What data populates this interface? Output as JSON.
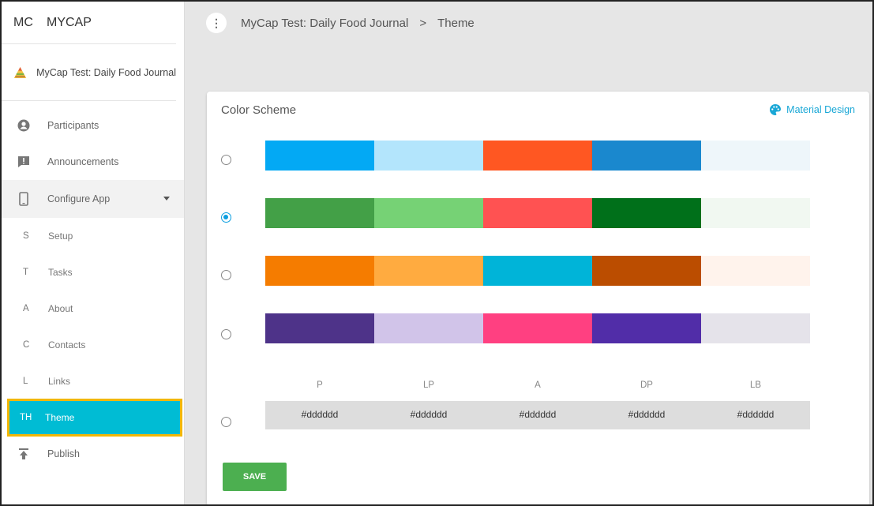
{
  "brand": {
    "abbr": "MC",
    "name": "MYCAP"
  },
  "project": {
    "name": "MyCap Test: Daily Food Journal"
  },
  "nav": {
    "participants": "Participants",
    "announcements": "Announcements",
    "configure_app": "Configure App",
    "sub_items": [
      {
        "abbr": "S",
        "label": "Setup"
      },
      {
        "abbr": "T",
        "label": "Tasks"
      },
      {
        "abbr": "A",
        "label": "About"
      },
      {
        "abbr": "C",
        "label": "Contacts"
      },
      {
        "abbr": "L",
        "label": "Links"
      },
      {
        "abbr": "TH",
        "label": "Theme"
      }
    ],
    "publish": "Publish"
  },
  "header": {
    "project": "MyCap Test: Daily Food Journal",
    "separator": ">",
    "page": "Theme"
  },
  "card": {
    "title": "Color Scheme",
    "material_link": "Material Design",
    "schemes": [
      {
        "selected": false,
        "colors": [
          "#03a9f4",
          "#b3e5fc",
          "#ff5722",
          "#1a88ce",
          "#eef6fa"
        ]
      },
      {
        "selected": true,
        "colors": [
          "#43a047",
          "#76d275",
          "#ff5252",
          "#00701a",
          "#f1f8f1"
        ]
      },
      {
        "selected": false,
        "colors": [
          "#f57c00",
          "#ffab40",
          "#00b4d8",
          "#bb4d00",
          "#fff3ec"
        ]
      },
      {
        "selected": false,
        "colors": [
          "#4e3389",
          "#d1c4e9",
          "#ff4081",
          "#512da8",
          "#e5e3ea"
        ]
      }
    ],
    "custom_headers": [
      "P",
      "LP",
      "A",
      "DP",
      "LB"
    ],
    "custom_values": [
      "#dddddd",
      "#dddddd",
      "#dddddd",
      "#dddddd",
      "#dddddd"
    ],
    "custom_selected": false,
    "save_label": "SAVE"
  },
  "colors": {
    "accent_active": "#00bcd4",
    "highlight_border": "#f2b705",
    "save_button": "#4caf50",
    "link": "#19a7d6"
  }
}
